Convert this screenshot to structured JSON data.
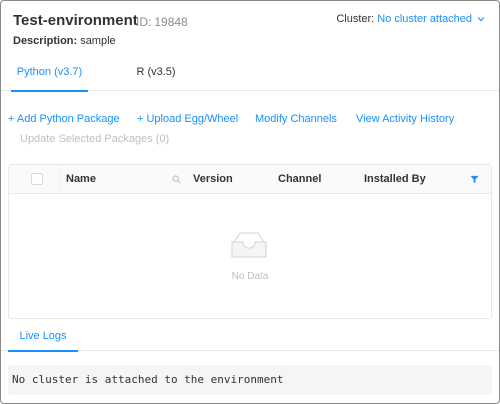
{
  "header": {
    "title": "Test-environment",
    "id_label": "ID:",
    "id_value": "19848",
    "description_label": "Description:",
    "description_value": "sample",
    "cluster_label": "Cluster:",
    "cluster_value": "No cluster attached",
    "cluster_icon": "chevron-down-icon"
  },
  "tabs": [
    {
      "label": "Python (v3.7)",
      "active": true
    },
    {
      "label": "R (v3.5)",
      "active": false
    }
  ],
  "actions": {
    "add_package": "+ Add Python Package",
    "upload": "+ Upload Egg/Wheel",
    "modify_channels": "Modify Channels",
    "view_activity": "View Activity History",
    "update_selected": "Update Selected Packages (0)"
  },
  "table": {
    "columns": [
      "Name",
      "Version",
      "Channel",
      "Installed By"
    ],
    "empty_text": "No Data",
    "icons": {
      "search": "search-icon",
      "filter": "filter-icon",
      "empty": "empty-inbox-icon"
    }
  },
  "logs": {
    "tab_label": "Live Logs",
    "message": "No cluster is attached to the environment"
  },
  "colors": {
    "accent": "#1890ff",
    "disabled": "#bfbfbf",
    "border": "#e8e8e8"
  }
}
